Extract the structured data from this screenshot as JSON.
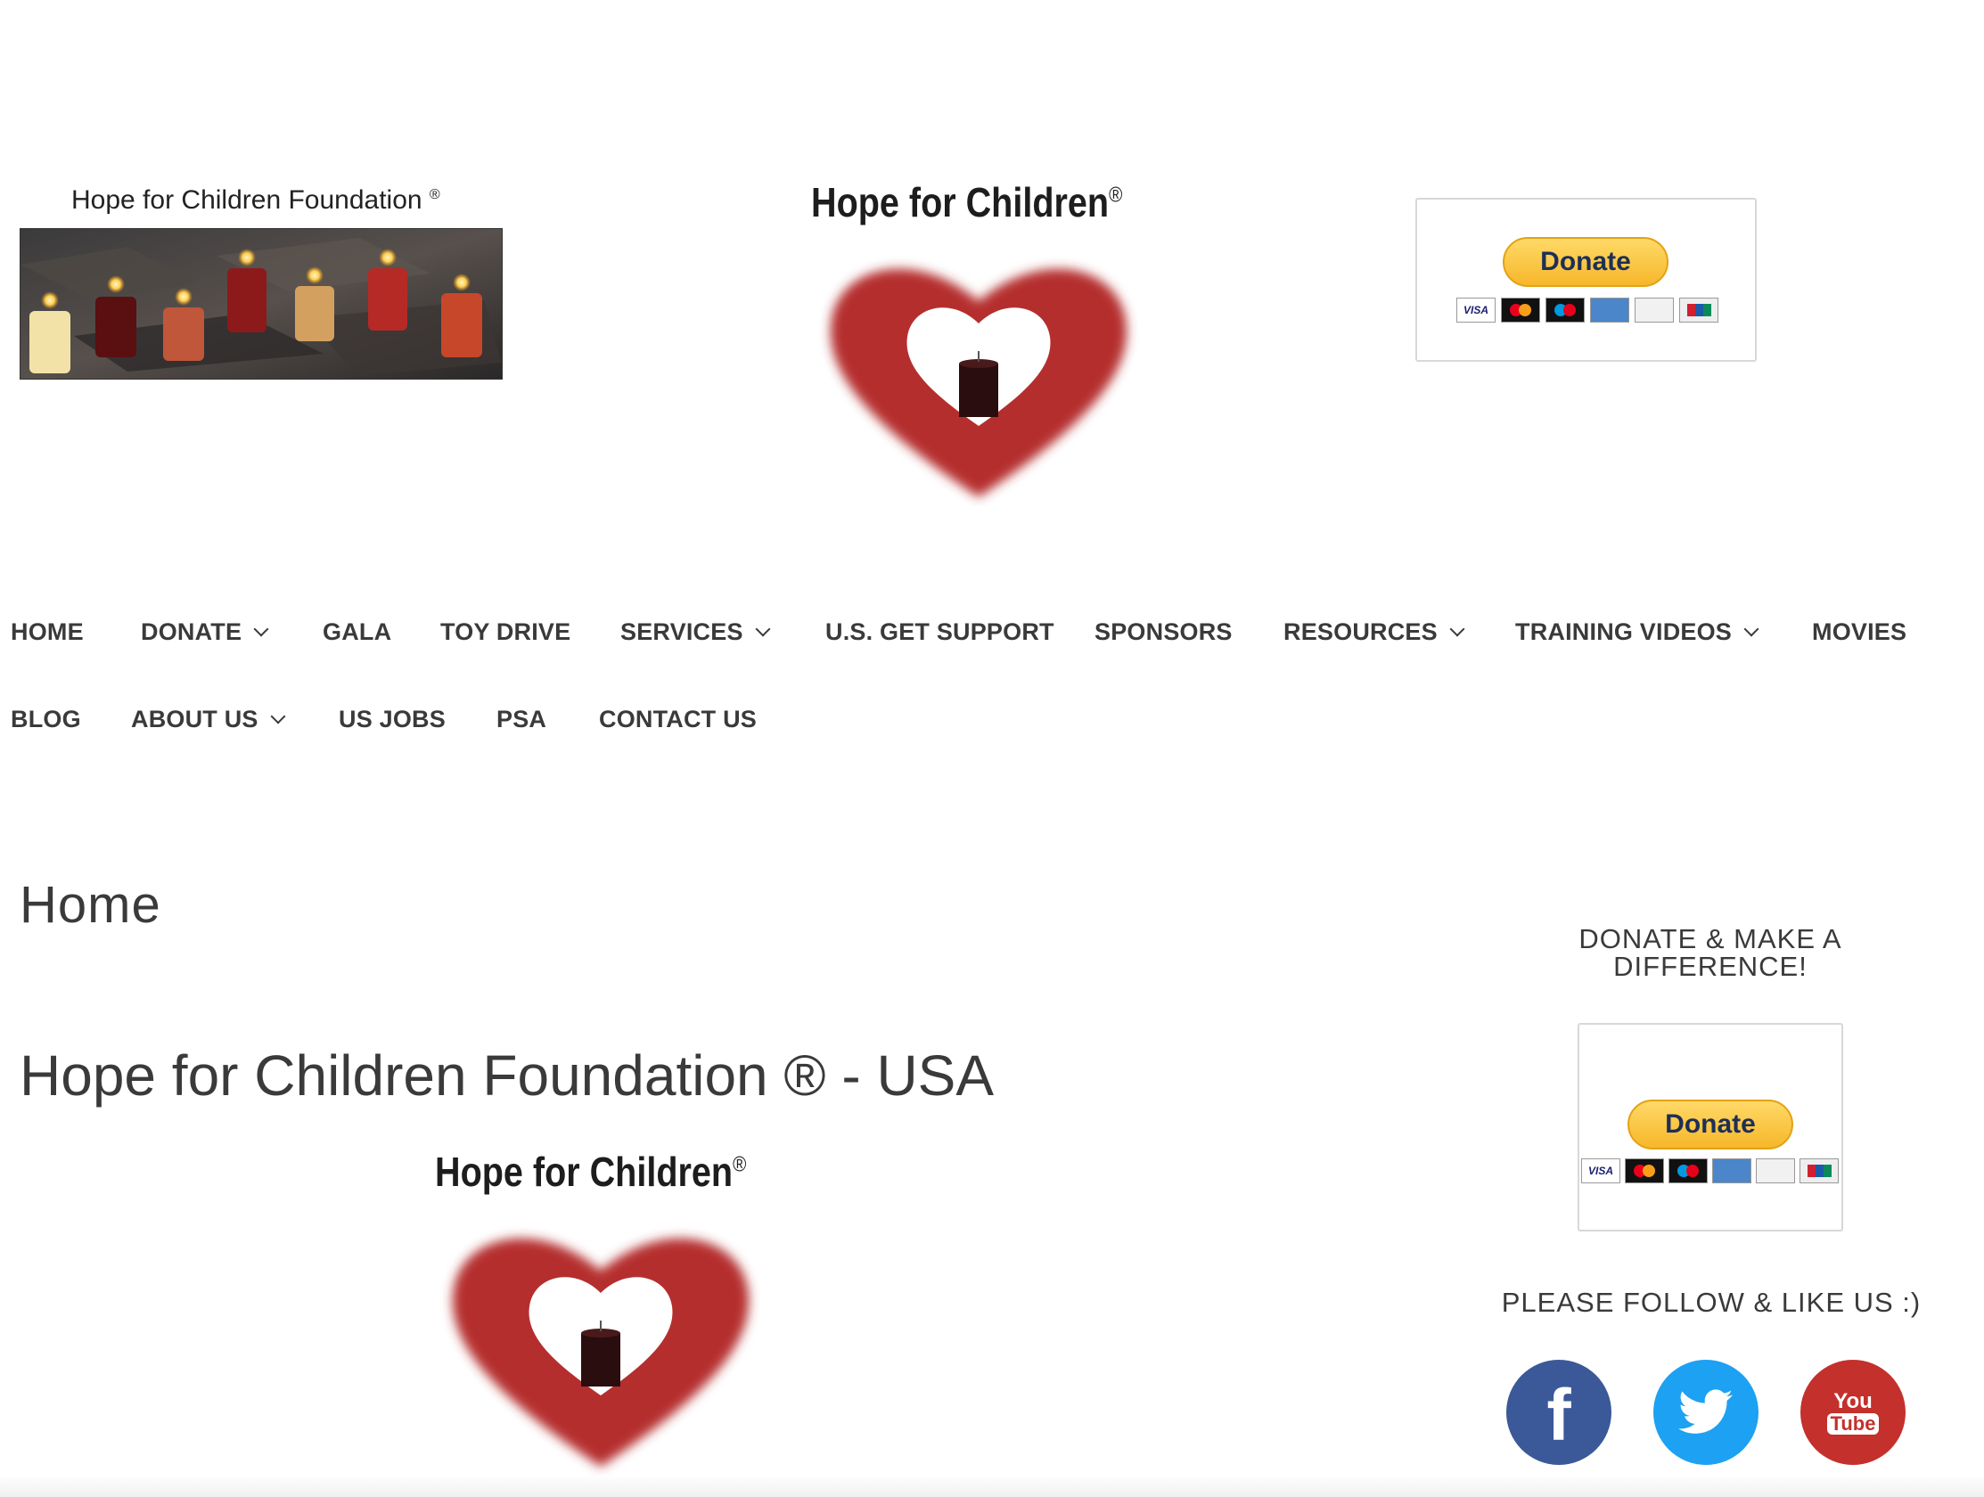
{
  "header": {
    "banner_title": "Hope for Children Foundation",
    "banner_reg": "®",
    "logo_title": "Hope for Children",
    "logo_reg": "®",
    "donate_label": "Donate",
    "cards": [
      "VISA",
      "mastercard",
      "maestro",
      "american-express",
      "discover",
      "unionpay"
    ]
  },
  "nav": {
    "row1": [
      "HOME",
      "DONATE",
      "GALA",
      "TOY DRIVE",
      "SERVICES",
      "U.S. GET SUPPORT",
      "SPONSORS",
      "RESOURCES",
      "TRAINING VIDEOS",
      "MOVIES"
    ],
    "row2": [
      "BLOG",
      "ABOUT US",
      "US JOBS",
      "PSA",
      "CONTACT US"
    ]
  },
  "main": {
    "page_title": "Home",
    "entry_title": "Hope for Children Foundation ® - USA",
    "logo_title": "Hope for Children",
    "logo_reg": "®"
  },
  "sidebar": {
    "donate_title": "DONATE & MAKE A DIFFERENCE!",
    "donate_label": "Donate",
    "follow_title": "PLEASE FOLLOW & LIKE US :)",
    "social": {
      "facebook": "f",
      "youtube_you": "You",
      "youtube_tube": "Tube"
    }
  },
  "colors": {
    "heart": "#b52d2d",
    "facebook": "#3b5998",
    "twitter": "#1da1f2",
    "youtube": "#c4302b",
    "paypal": "#f6b72a"
  }
}
